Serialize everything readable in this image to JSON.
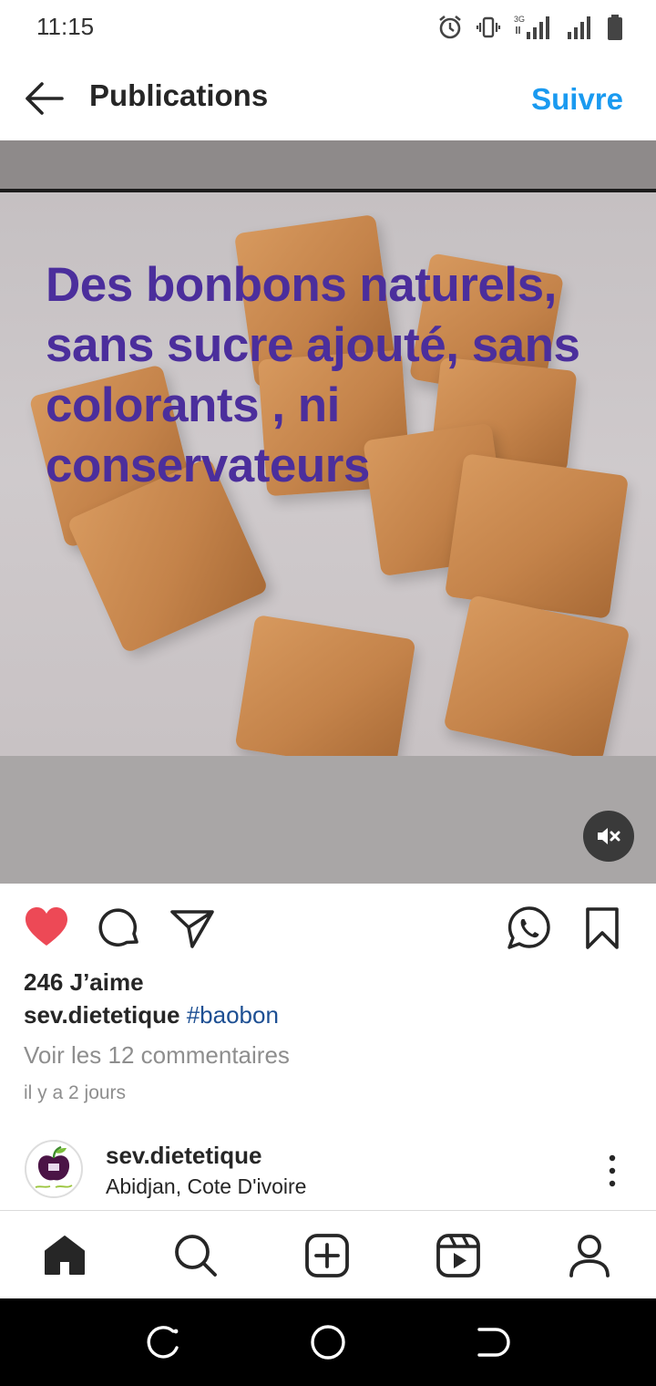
{
  "status_bar": {
    "time": "11:15",
    "icons": [
      "alarm-icon",
      "vibrate-icon",
      "signal-3g-icon",
      "signal-icon",
      "battery-icon"
    ],
    "network_label": "3G"
  },
  "header": {
    "title": "Publications",
    "follow_label": "Suivre"
  },
  "post": {
    "overlay_text": "Des bonbons naturels, sans sucre ajouté, sans colorants , ni conservateurs",
    "colors": {
      "overlay_text": "#4b2e9c",
      "like_heart": "#ed4956",
      "follow": "#1a9af0",
      "hashtag": "#1d4f93"
    },
    "likes_text": "246 J’aime",
    "liked": true,
    "caption_user": "sev.dietetique",
    "caption_tag": "#baobon",
    "comments_link": "Voir les 12 commentaires",
    "time_ago": "il y a 2 jours"
  },
  "next_post": {
    "username": "sev.dietetique",
    "location": "Abidjan, Cote D'ivoire"
  },
  "tab_bar": [
    "home-icon",
    "search-icon",
    "new-post-icon",
    "reels-icon",
    "profile-icon"
  ],
  "system_nav": [
    "recents-icon",
    "home-circle-icon",
    "back-icon"
  ]
}
